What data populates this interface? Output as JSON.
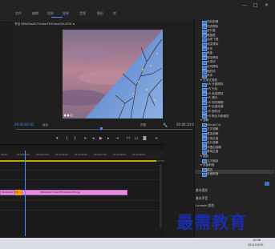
{
  "menubar": {
    "items": [
      {
        "label": "文件",
        "active": false
      },
      {
        "label": "编辑",
        "active": false
      },
      {
        "label": "组装",
        "active": false
      },
      {
        "label": "效果",
        "active": true
      },
      {
        "label": "音频",
        "active": false
      },
      {
        "label": "图形",
        "active": false
      },
      {
        "label": "库",
        "active": false
      }
    ],
    "window_buttons": [
      "—",
      "□",
      "✕"
    ]
  },
  "monitor": {
    "tab_title": "节目 IMAG0wZU7iXuke7EXVIwxCW-IZ09 ≡",
    "timecode_current": "00:00:02:01",
    "fit_label": "适合",
    "quality_label": "完整",
    "timecode_duration": "00:00:10:00",
    "colors": {
      "accent": "#4a8fff"
    }
  },
  "controls": {
    "buttons": [
      "marker-icon",
      "in-point-icon",
      "out-point-icon",
      "go-to-in-icon",
      "step-back-icon",
      "play-icon",
      "step-forward-icon",
      "go-to-out-icon",
      "lift-icon",
      "extract-icon",
      "export-frame-icon"
    ]
  },
  "timeline": {
    "ruler_labels": [
      "00:00",
      "00:00:03:00",
      "00:00:04:00",
      "00:00:05:00",
      "00:00:06:00",
      "00:00:07:00",
      "00:00:08:00",
      "00:00:09:00"
    ],
    "clips": [
      {
        "label": "IMAG0wZU7iXuke7EXVIwxCW-IZ09.jpg",
        "color": "#e58ae0"
      },
      {
        "label": "IMAG0wZU7iXuke7EXVIwxCW-IZ09.jpg",
        "color": "#e58ae0"
      }
    ],
    "fx_badge": "fx"
  },
  "effects": {
    "items": [
      {
        "label": "同向剪辑",
        "type": "item"
      },
      {
        "label": "同向擦除",
        "type": "item"
      },
      {
        "label": "百叶窗",
        "type": "item"
      },
      {
        "label": "螺旋框",
        "type": "item"
      },
      {
        "label": "油漆飞溅",
        "type": "item"
      },
      {
        "label": "渐变擦除",
        "type": "item"
      },
      {
        "label": "风车",
        "type": "item"
      },
      {
        "label": "棋盘",
        "type": "item"
      },
      {
        "label": "楔形擦除",
        "type": "item"
      },
      {
        "label": "水波块",
        "type": "item"
      },
      {
        "label": "径向擦除",
        "type": "item"
      },
      {
        "label": "随机块",
        "type": "item"
      },
      {
        "label": "风车",
        "type": "item"
      },
      {
        "label": "沉浸式视频",
        "type": "folder"
      },
      {
        "label": "VR 光圈擦除",
        "type": "item"
      },
      {
        "label": "VR 光线",
        "type": "item"
      },
      {
        "label": "VR 渐变擦除",
        "type": "item"
      },
      {
        "label": "VR 漏光",
        "type": "item"
      },
      {
        "label": "VR 球形模糊",
        "type": "item"
      },
      {
        "label": "VR 色度泄漏",
        "type": "item"
      },
      {
        "label": "VR 随机块",
        "type": "item"
      },
      {
        "label": "VR 默比乌斯缩放",
        "type": "item"
      },
      {
        "label": "溶解",
        "type": "folder"
      },
      {
        "label": "MorphCut",
        "type": "item"
      },
      {
        "label": "交叉溶解",
        "type": "item"
      },
      {
        "label": "叠加溶解",
        "type": "item"
      },
      {
        "label": "白场过渡",
        "type": "item"
      },
      {
        "label": "胶片溶解",
        "type": "item"
      },
      {
        "label": "非叠加溶解",
        "type": "item"
      },
      {
        "label": "黑场过渡",
        "type": "item"
      },
      {
        "label": "缩放",
        "type": "folder"
      },
      {
        "label": "交叉缩放",
        "type": "item"
      },
      {
        "label": "页面剥落",
        "type": "folder"
      },
      {
        "label": "翻页",
        "type": "item"
      },
      {
        "label": "页面剥落",
        "type": "item"
      }
    ],
    "bottom": [
      "基本图形",
      "基本声音",
      "Lumetri 颜色"
    ]
  },
  "watermark": "最需教育",
  "taskbar": {
    "time": "10:08",
    "date": "2021/10/15"
  }
}
